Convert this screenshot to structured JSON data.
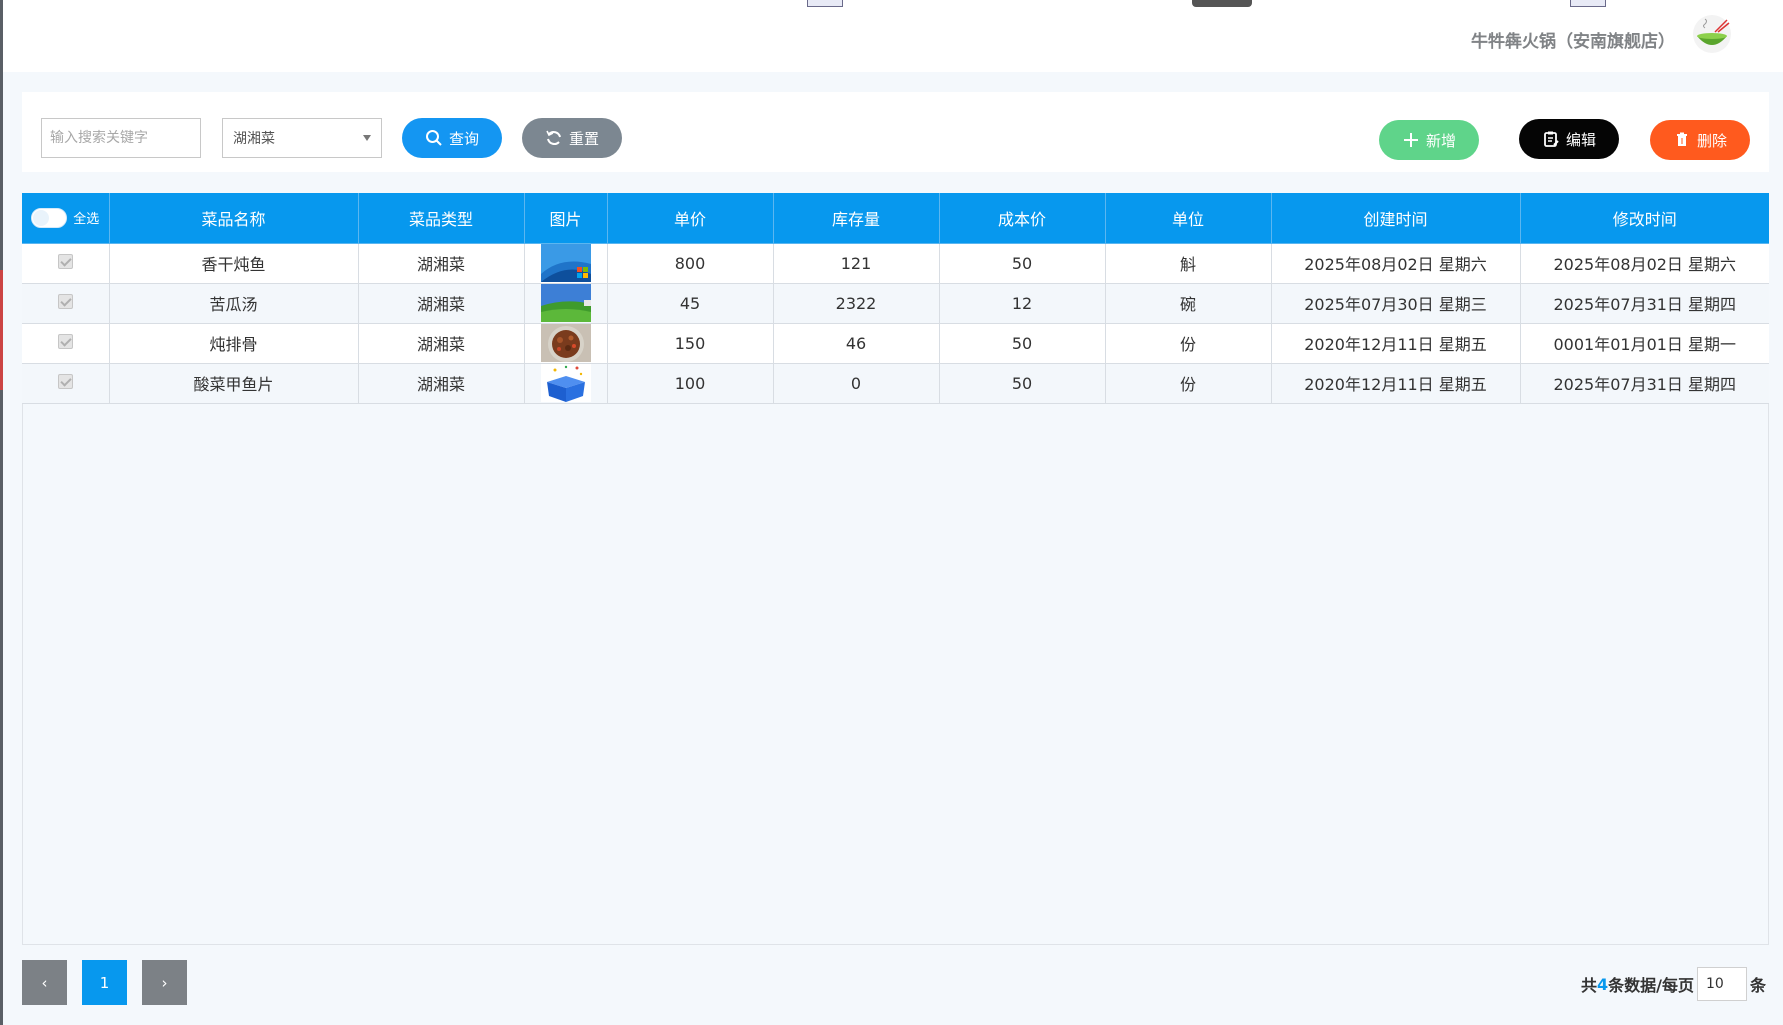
{
  "header": {
    "store_name": "牛牪犇火锅（安南旗舰店）",
    "logo_icon": "hotpot-bowl-icon"
  },
  "toolbar": {
    "search_placeholder": "输入搜索关键字",
    "category_selected": "湖湘菜",
    "query_label": "查询",
    "reset_label": "重置",
    "add_label": "新增",
    "edit_label": "编辑",
    "delete_label": "删除"
  },
  "colors": {
    "primary": "#0798ee",
    "query": "#1496f2",
    "reset": "#7c8791",
    "add": "#5fd48a",
    "edit": "#050505",
    "delete": "#ff5a1e"
  },
  "table": {
    "select_all_label": "全选",
    "columns": [
      "菜品名称",
      "菜品类型",
      "图片",
      "单价",
      "库存量",
      "成本价",
      "单位",
      "创建时间",
      "修改时间"
    ],
    "rows": [
      {
        "name": "香干炖鱼",
        "type": "湖湘菜",
        "image": "windows7-wallpaper",
        "price": "800",
        "stock": "121",
        "cost": "50",
        "unit": "斛",
        "created": "2025年08月02日 星期六",
        "modified": "2025年08月02日 星期六"
      },
      {
        "name": "苦瓜汤",
        "type": "湖湘菜",
        "image": "green-hill-landscape",
        "price": "45",
        "stock": "2322",
        "cost": "12",
        "unit": "碗",
        "created": "2025年07月30日 星期三",
        "modified": "2025年07月31日 星期四"
      },
      {
        "name": "炖排骨",
        "type": "湖湘菜",
        "image": "braised-ribs-dish",
        "price": "150",
        "stock": "46",
        "cost": "50",
        "unit": "份",
        "created": "2020年12月11日 星期五",
        "modified": "0001年01月01日 星期一"
      },
      {
        "name": "酸菜甲鱼片",
        "type": "湖湘菜",
        "image": "blue-gift-box",
        "price": "100",
        "stock": "0",
        "cost": "50",
        "unit": "份",
        "created": "2020年12月11日 星期五",
        "modified": "2025年07月31日 星期四"
      }
    ]
  },
  "pagination": {
    "prev": "‹",
    "current": "1",
    "next": "›",
    "total_prefix": "共",
    "total": "4",
    "total_mid": "条数据/每页",
    "page_size": "10",
    "total_suffix": "条"
  }
}
